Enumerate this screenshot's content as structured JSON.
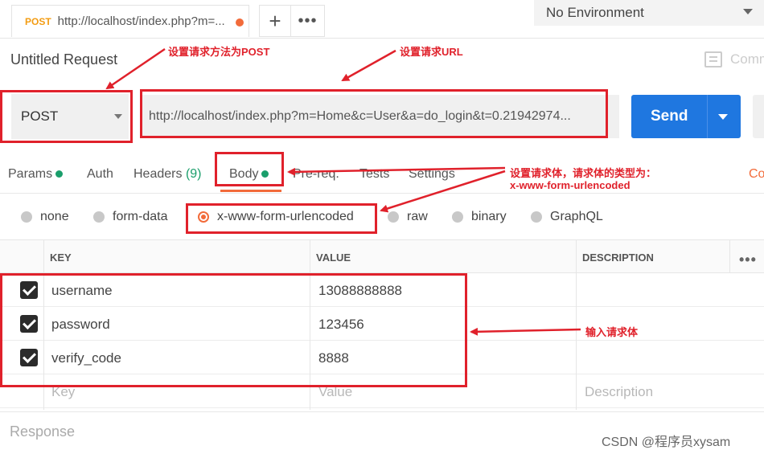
{
  "tabstrip": {
    "tab_method": "POST",
    "tab_url": "http://localhost/index.php?m=...",
    "new_tab": "+",
    "more": "•••"
  },
  "environment": {
    "label": "No Environment"
  },
  "request": {
    "title": "Untitled Request",
    "comments_label": "Comm",
    "method": "POST",
    "url": "http://localhost/index.php?m=Home&c=User&a=do_login&t=0.21942974...",
    "send_label": "Send"
  },
  "section_tabs": {
    "params": "Params",
    "auth": "Auth",
    "headers": "Headers",
    "headers_count": "(9)",
    "body": "Body",
    "prereq": "Pre-req.",
    "tests": "Tests",
    "settings": "Settings",
    "cookies": "Co"
  },
  "body_types": [
    {
      "label": "none",
      "selected": false
    },
    {
      "label": "form-data",
      "selected": false
    },
    {
      "label": "x-www-form-urlencoded",
      "selected": true
    },
    {
      "label": "raw",
      "selected": false
    },
    {
      "label": "binary",
      "selected": false
    },
    {
      "label": "GraphQL",
      "selected": false
    }
  ],
  "table": {
    "headers": {
      "key": "KEY",
      "value": "VALUE",
      "description": "DESCRIPTION"
    },
    "more": "•••",
    "rows": [
      {
        "key": "username",
        "value": "13088888888",
        "checked": true
      },
      {
        "key": "password",
        "value": "123456",
        "checked": true
      },
      {
        "key": "verify_code",
        "value": "8888",
        "checked": true
      }
    ],
    "placeholder": {
      "key": "Key",
      "value": "Value",
      "description": "Description"
    }
  },
  "response": {
    "label": "Response"
  },
  "annotations": {
    "method_note": "设置请求方法为POST",
    "url_note": "设置请求URL",
    "body_note_line1": "设置请求体，请求体的类型为：",
    "body_note_line2": "x-www-form-urlencoded",
    "rows_note": "输入请求体"
  },
  "watermark": "CSDN @程序员xysam",
  "colors": {
    "accent_orange": "#f26b3a",
    "send_blue": "#1f77e0",
    "annotation_red": "#e0212b",
    "status_green": "#1a9e6b"
  }
}
